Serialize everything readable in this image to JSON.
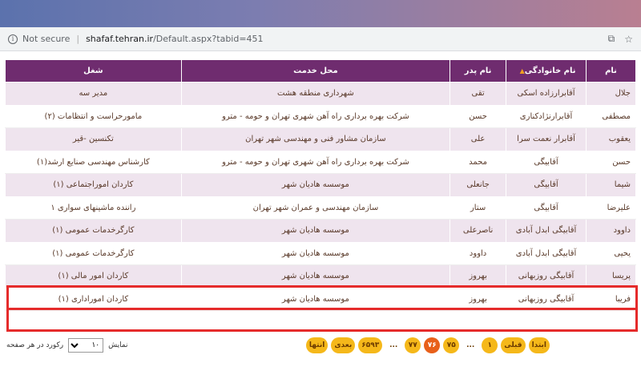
{
  "browser": {
    "security_text": "Not secure",
    "url_host": "shafaf.tehran.ir",
    "url_path": "/Default.aspx?tabid=451"
  },
  "table": {
    "headers": {
      "name": "نام",
      "family": "نام خانوادگی",
      "father": "نام پدر",
      "workplace": "محل خدمت",
      "job": "شغل"
    },
    "rows": [
      {
        "name": "جلال",
        "family": "آقابرارزاده اسکی",
        "father": "تقی",
        "workplace": "شهرداری منطقه هشت",
        "job": "مدیر سه"
      },
      {
        "name": "مصطفی",
        "family": "آقابرارنژادکناری",
        "father": "حسن",
        "workplace": "شرکت بهره برداری راه آهن شهری تهران و حومه - مترو",
        "job": "مامورحراست و انتظامات (۲)"
      },
      {
        "name": "یعقوب",
        "family": "آقابرار نعمت سرا",
        "father": "علی",
        "workplace": "سازمان مشاور فنی و مهندسی شهر تهران",
        "job": "تکنسین -قیر"
      },
      {
        "name": "حسن",
        "family": "آقابیگی",
        "father": "محمد",
        "workplace": "شرکت بهره برداری راه آهن شهری تهران و حومه - مترو",
        "job": "کارشناس مهندسی صنایع ارشد(۱)"
      },
      {
        "name": "شیما",
        "family": "آقابیگی",
        "father": "جانعلی",
        "workplace": "موسسه هادیان شهر",
        "job": "کاردان اموراجتماعی (۱)"
      },
      {
        "name": "علیرضا",
        "family": "آقابیگی",
        "father": "ستار",
        "workplace": "سازمان مهندسی و عمران شهر تهران",
        "job": "راننده ماشینهای سواری ۱"
      },
      {
        "name": "داوود",
        "family": "آقابیگی ابدل آبادی",
        "father": "ناصرعلی",
        "workplace": "موسسه هادیان شهر",
        "job": "کارگرخدمات عمومی (۱)"
      },
      {
        "name": "یحیی",
        "family": "آقابیگی ابدل آبادی",
        "father": "داوود",
        "workplace": "موسسه هادیان شهر",
        "job": "کارگرخدمات عمومی (۱)"
      },
      {
        "name": "پریسا",
        "family": "آقابیگی روزبهانی",
        "father": "بهروز",
        "workplace": "موسسه هادیان شهر",
        "job": "کاردان امور مالی (۱)"
      },
      {
        "name": "فریبا",
        "family": "آقابیگی روزبهانی",
        "father": "بهروز",
        "workplace": "موسسه هادیان شهر",
        "job": "کاردان اموراداری (۱)"
      }
    ]
  },
  "pager": {
    "first": "ابتدا",
    "prev": "قبلی",
    "page1": "۱",
    "dots": "...",
    "p75": "۷۵",
    "p76": "۷۶",
    "p77": "۷۷",
    "last_num": "۶۵۹۳",
    "next": "بعدی",
    "end": "انتها"
  },
  "pagesize": {
    "show_label": "نمایش",
    "value": "۱۰",
    "suffix": "رکورد در هر صفحه"
  }
}
